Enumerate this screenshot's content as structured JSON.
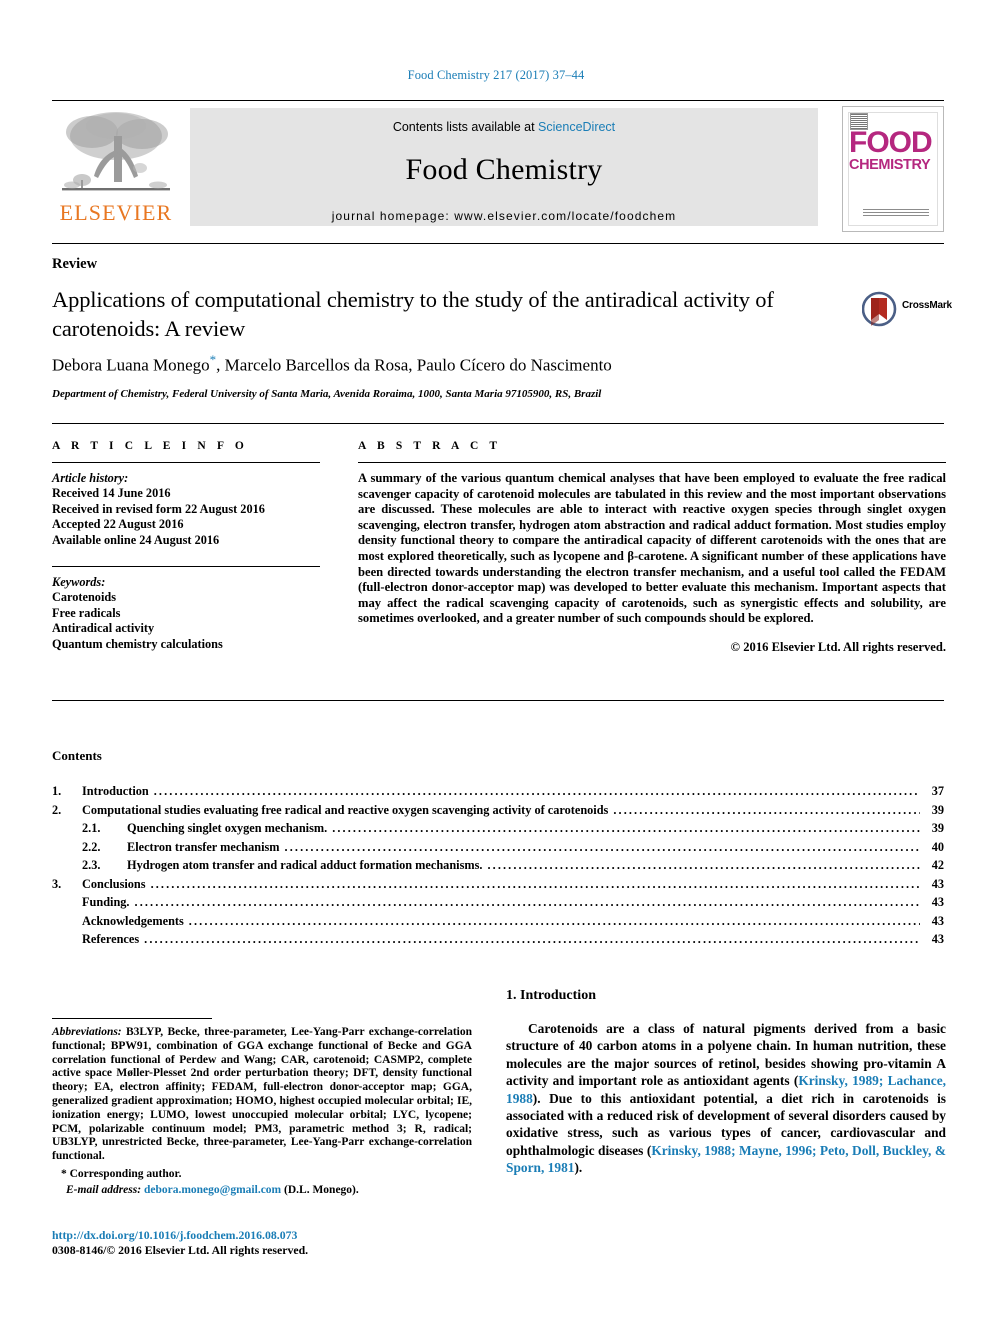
{
  "running_head": "Food Chemistry 217 (2017) 37–44",
  "masthead": {
    "publisher": "ELSEVIER",
    "contents_prefix": "Contents lists available at ",
    "contents_link": "ScienceDirect",
    "journal_name": "Food Chemistry",
    "homepage": "journal homepage: www.elsevier.com/locate/foodchem",
    "cover": {
      "line1": "FOOD",
      "line2": "CHEMISTRY"
    },
    "brand_orange": "#e87722",
    "link_blue": "#1a7db6",
    "cover_magenta": "#b5277f"
  },
  "article": {
    "doctype": "Review",
    "title": "Applications of computational chemistry to the study of the antiradical activity of carotenoids: A review",
    "authors": "Debora Luana Monego",
    "authors_rest": ", Marcelo Barcellos da Rosa, Paulo Cícero do Nascimento",
    "corresponding_marker": "*",
    "affiliation": "Department of Chemistry, Federal University of Santa Maria, Avenida Roraima, 1000, Santa Maria 97105900, RS, Brazil",
    "crossmark_label": "CrossMark"
  },
  "article_info": {
    "heading": "A R T I C L E   I N F O",
    "history_label": "Article history:",
    "history": [
      "Received 14 June 2016",
      "Received in revised form 22 August 2016",
      "Accepted 22 August 2016",
      "Available online 24 August 2016"
    ],
    "keywords_label": "Keywords:",
    "keywords": [
      "Carotenoids",
      "Free radicals",
      "Antiradical activity",
      "Quantum chemistry calculations"
    ]
  },
  "abstract": {
    "heading": "A B S T R A C T",
    "body": "A summary of the various quantum chemical analyses that have been employed to evaluate the free radical scavenger capacity of carotenoid molecules are tabulated in this review and the most important observations are discussed. These molecules are able to interact with reactive oxygen species through singlet oxygen scavenging, electron transfer, hydrogen atom abstraction and radical adduct formation. Most studies employ density functional theory to compare the antiradical capacity of different carotenoids with the ones that are most explored theoretically, such as lycopene and β-carotene. A significant number of these applications have been directed towards understanding the electron transfer mechanism, and a useful tool called the FEDAM (full-electron donor-acceptor map) was developed to better evaluate this mechanism. Important aspects that may affect the radical scavenging capacity of carotenoids, such as synergistic effects and solubility, are sometimes overlooked, and a greater number of such compounds should be explored.",
    "copyright": "© 2016 Elsevier Ltd. All rights reserved."
  },
  "contents": {
    "heading": "Contents",
    "entries": [
      {
        "num": "1.",
        "sub": "",
        "label": "Introduction",
        "page": "37",
        "level": 1
      },
      {
        "num": "2.",
        "sub": "",
        "label": "Computational studies evaluating free radical and reactive oxygen scavenging activity of carotenoids",
        "page": "39",
        "level": 1
      },
      {
        "num": "",
        "sub": "2.1.",
        "label": "Quenching singlet oxygen mechanism.",
        "page": "39",
        "level": 2
      },
      {
        "num": "",
        "sub": "2.2.",
        "label": "Electron transfer mechanism",
        "page": "40",
        "level": 2
      },
      {
        "num": "",
        "sub": "2.3.",
        "label": "Hydrogen atom transfer and radical adduct formation mechanisms.",
        "page": "42",
        "level": 2
      },
      {
        "num": "3.",
        "sub": "",
        "label": "Conclusions",
        "page": "43",
        "level": 1
      },
      {
        "num": "",
        "sub": "",
        "label": "Funding.",
        "page": "43",
        "level": 3
      },
      {
        "num": "",
        "sub": "",
        "label": "Acknowledgements",
        "page": "43",
        "level": 3
      },
      {
        "num": "",
        "sub": "",
        "label": "References",
        "page": "43",
        "level": 3
      }
    ]
  },
  "footnotes": {
    "abbrev_label": "Abbreviations:",
    "abbrev_body": " B3LYP, Becke, three-parameter, Lee-Yang-Parr exchange-correlation functional; BPW91, combination of GGA exchange functional of Becke and GGA correlation functional of Perdew and Wang; CAR, carotenoid; CASMP2, complete active space Møller-Plesset 2nd order perturbation theory; DFT, density functional theory; EA, electron affinity; FEDAM, full-electron donor-acceptor map; GGA, generalized gradient approximation; HOMO, highest occupied molecular orbital; IE, ionization energy; LUMO, lowest unoccupied molecular orbital; LYC, lycopene; PCM, polarizable continuum model; PM3, parametric method 3; R, radical; UB3LYP, unrestricted Becke, three-parameter, Lee-Yang-Parr exchange-correlation functional.",
    "corresponding": "* Corresponding author.",
    "email_label": "E-mail address:",
    "email": "debora.monego@gmail.com",
    "email_suffix": " (D.L. Monego).",
    "doi": "http://dx.doi.org/10.1016/j.foodchem.2016.08.073",
    "issn_line": "0308-8146/© 2016 Elsevier Ltd. All rights reserved."
  },
  "introduction": {
    "heading": "1. Introduction",
    "para_1a": "Carotenoids are a class of natural pigments derived from a basic structure of 40 carbon atoms in a polyene chain. In human nutrition, these molecules are the major sources of retinol, besides showing pro-vitamin A activity and important role as antioxidant agents (",
    "cite_1": "Krinsky, 1989; Lachance, 1988",
    "para_1b": "). Due to this antioxidant potential, a diet rich in carotenoids is associated with a reduced risk of development of several disorders caused by oxidative stress, such as various types of cancer, cardiovascular and ophthalmologic diseases (",
    "cite_2": "Krinsky, 1988; Mayne, 1996; Peto, Doll, Buckley, & Sporn, 1981",
    "para_1c": ")."
  }
}
